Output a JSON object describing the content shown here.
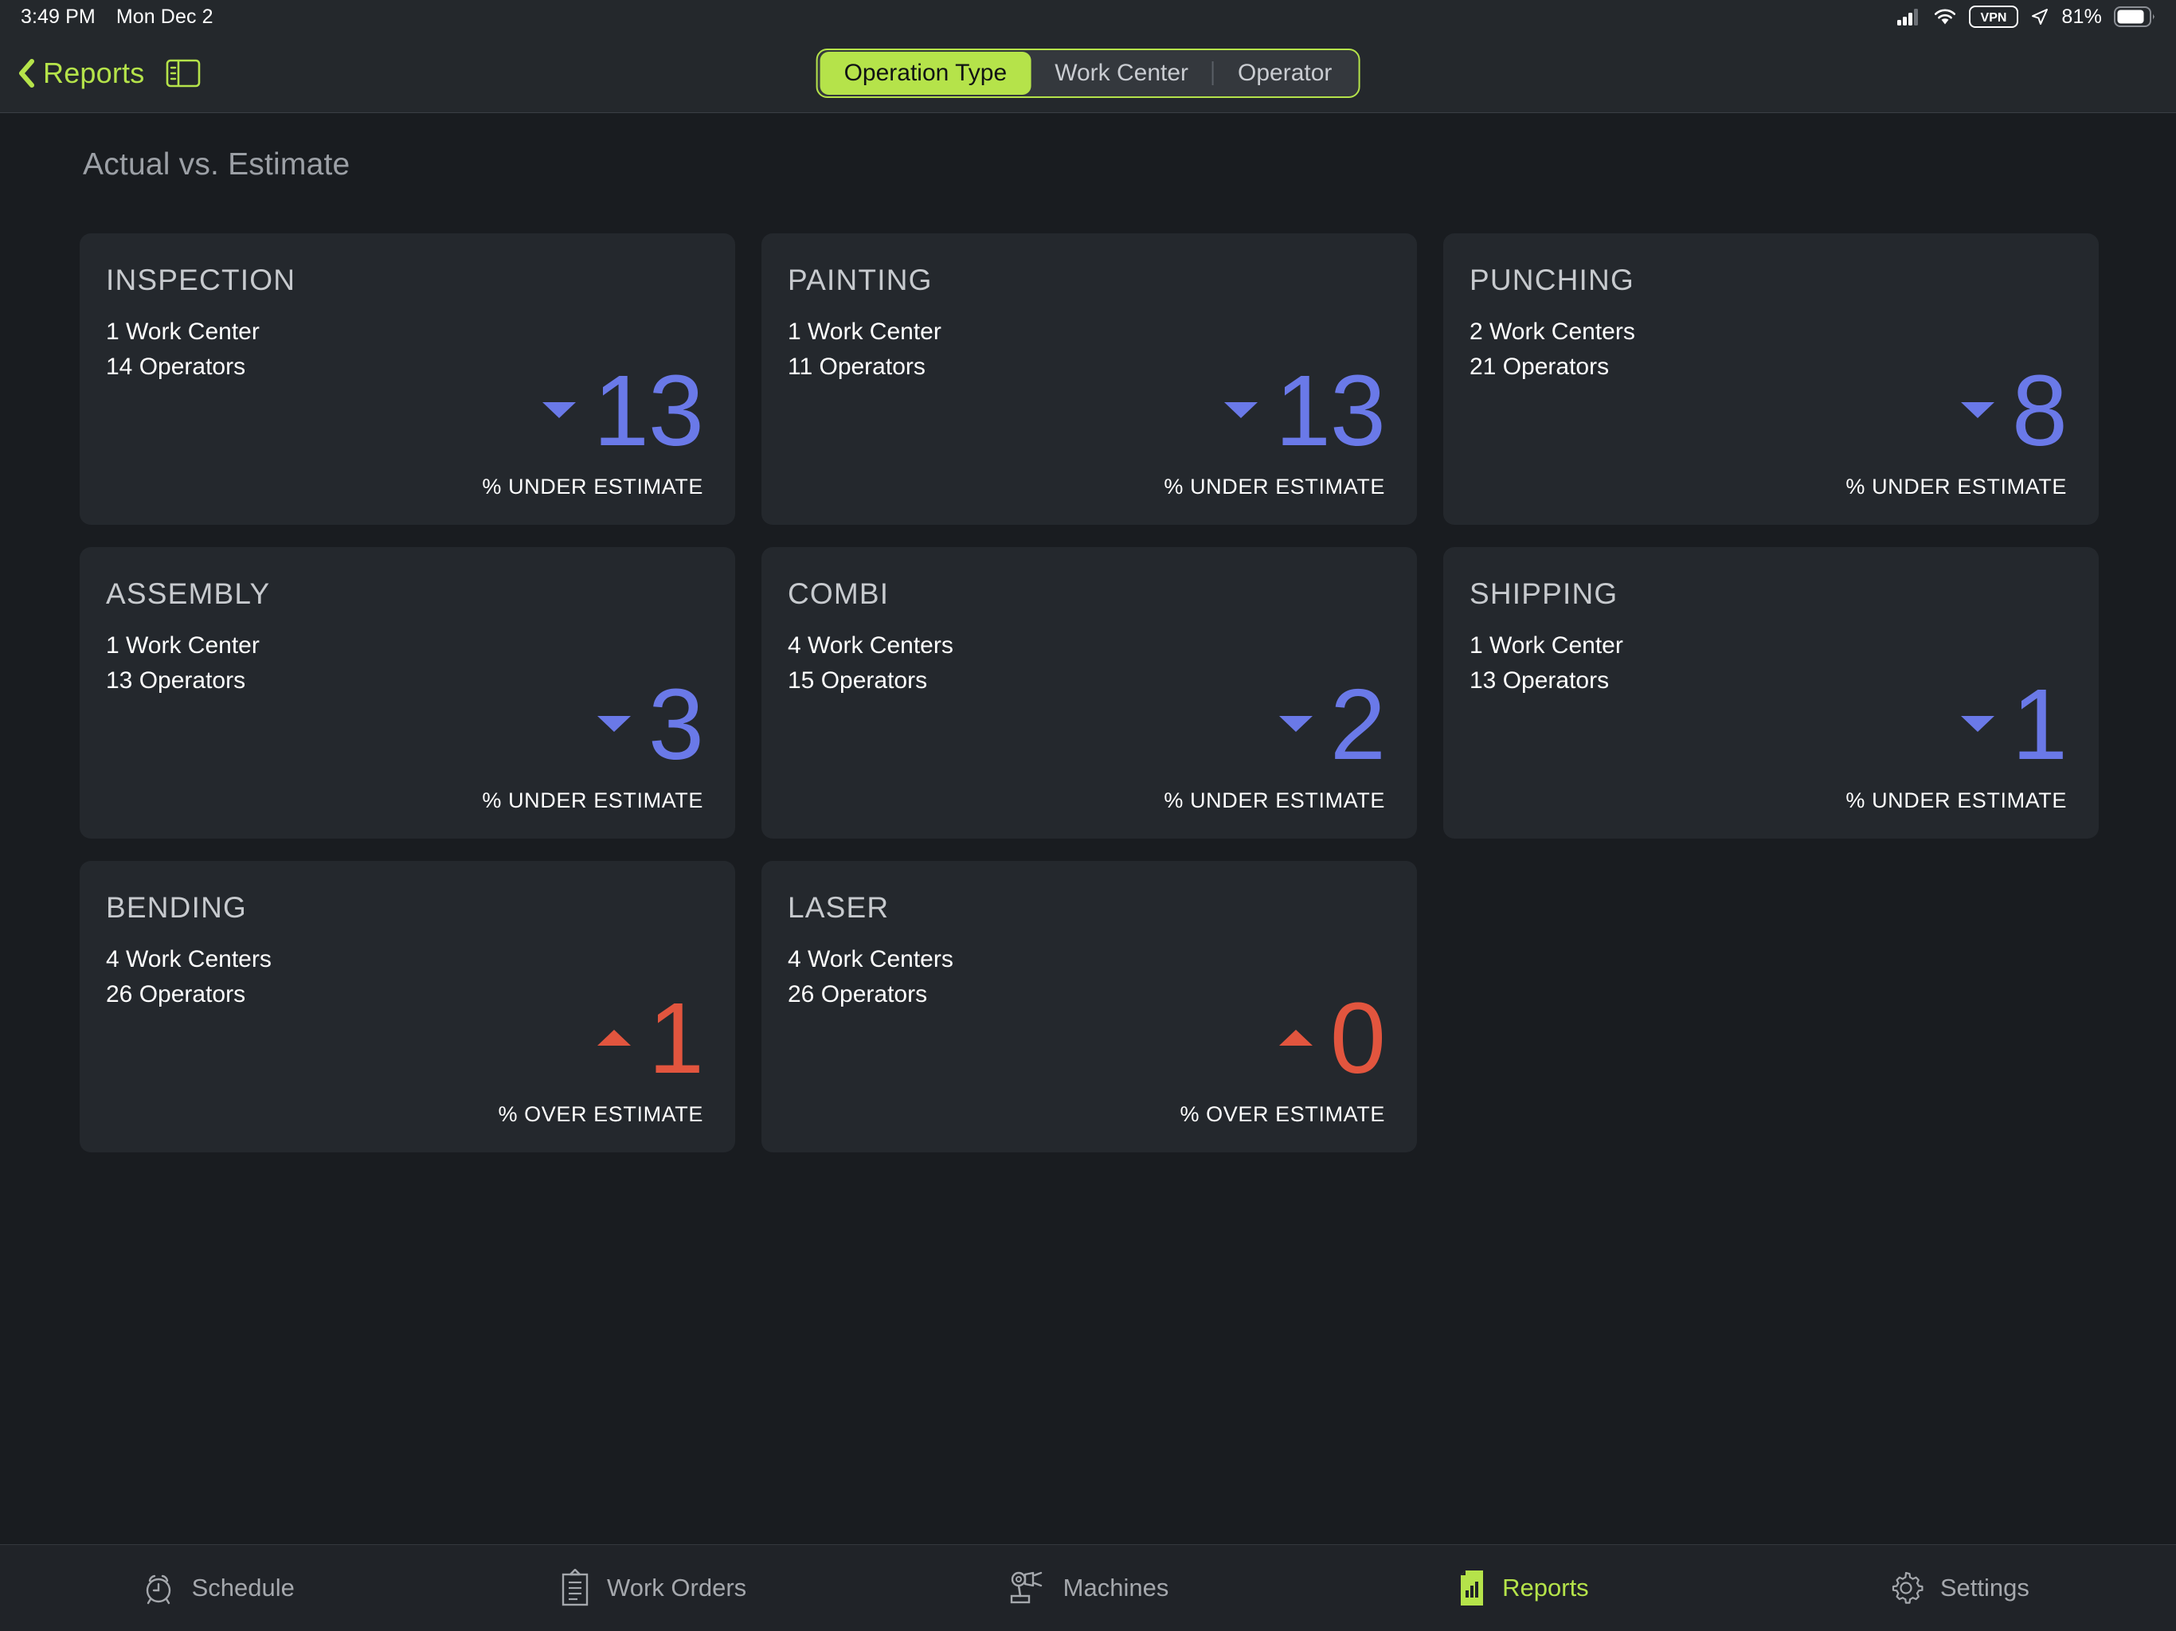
{
  "status_bar": {
    "time": "3:49 PM",
    "date": "Mon Dec 2",
    "vpn_label": "VPN",
    "battery_percent": "81%",
    "icons": [
      "cellular-signal-icon",
      "wifi-icon",
      "vpn-badge-icon",
      "location-arrow-icon",
      "battery-icon"
    ]
  },
  "nav": {
    "back_label": "Reports",
    "back_icon": "chevron-left-icon",
    "sidebar_toggle_icon": "sidebar-toggle-icon",
    "segments": [
      {
        "label": "Operation Type",
        "active": true
      },
      {
        "label": "Work Center",
        "active": false
      },
      {
        "label": "Operator",
        "active": false
      }
    ]
  },
  "main": {
    "section_title": "Actual vs. Estimate",
    "cards": [
      {
        "title": "INSPECTION",
        "work_centers": "1 Work Center",
        "operators": "14 Operators",
        "value": "13",
        "direction": "down",
        "caption": "% UNDER ESTIMATE"
      },
      {
        "title": "PAINTING",
        "work_centers": "1 Work Center",
        "operators": "11 Operators",
        "value": "13",
        "direction": "down",
        "caption": "% UNDER ESTIMATE"
      },
      {
        "title": "PUNCHING",
        "work_centers": "2 Work Centers",
        "operators": "21 Operators",
        "value": "8",
        "direction": "down",
        "caption": "% UNDER ESTIMATE"
      },
      {
        "title": "ASSEMBLY",
        "work_centers": "1 Work Center",
        "operators": "13 Operators",
        "value": "3",
        "direction": "down",
        "caption": "% UNDER ESTIMATE"
      },
      {
        "title": "COMBI",
        "work_centers": "4 Work Centers",
        "operators": "15 Operators",
        "value": "2",
        "direction": "down",
        "caption": "% UNDER ESTIMATE"
      },
      {
        "title": "SHIPPING",
        "work_centers": "1 Work Center",
        "operators": "13 Operators",
        "value": "1",
        "direction": "down",
        "caption": "% UNDER ESTIMATE"
      },
      {
        "title": "BENDING",
        "work_centers": "4 Work Centers",
        "operators": "26 Operators",
        "value": "1",
        "direction": "up",
        "caption": "% OVER ESTIMATE"
      },
      {
        "title": "LASER",
        "work_centers": "4 Work Centers",
        "operators": "26 Operators",
        "value": "0",
        "direction": "up",
        "caption": "% OVER ESTIMATE"
      }
    ]
  },
  "tab_bar": {
    "tabs": [
      {
        "label": "Schedule",
        "icon": "alarm-clock-icon",
        "active": false
      },
      {
        "label": "Work Orders",
        "icon": "clipboard-icon",
        "active": false
      },
      {
        "label": "Machines",
        "icon": "robot-arm-icon",
        "active": false
      },
      {
        "label": "Reports",
        "icon": "report-chart-icon",
        "active": true
      },
      {
        "label": "Settings",
        "icon": "gear-icon",
        "active": false
      }
    ]
  },
  "colors": {
    "accent_green": "#b5e34a",
    "under_blue": "#6a79e8",
    "over_red": "#e2553e",
    "page_bg": "#191c20",
    "card_bg": "#24282d",
    "bar_bg": "#24282c"
  }
}
